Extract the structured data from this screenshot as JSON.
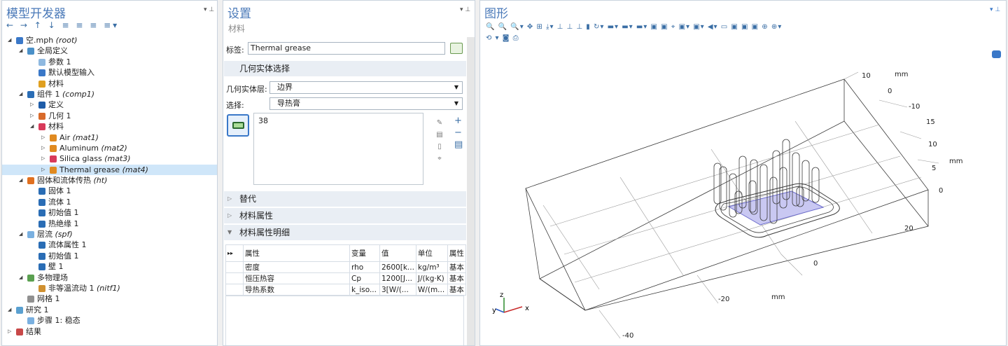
{
  "model_builder": {
    "title": "模型开发器",
    "tree": [
      {
        "label": "空.mph",
        "tag": "(root)",
        "level": 0,
        "toggle": "◢",
        "icon": "#3a78c8"
      },
      {
        "label": "全局定义",
        "tag": "",
        "level": 1,
        "toggle": "◢",
        "icon": "#4a90c8"
      },
      {
        "label": "参数 1",
        "tag": "",
        "level": 2,
        "toggle": "",
        "icon": "#8fb9e0"
      },
      {
        "label": "默认模型输入",
        "tag": "",
        "level": 2,
        "toggle": "",
        "icon": "#3a78c8"
      },
      {
        "label": "材料",
        "tag": "",
        "level": 2,
        "toggle": "",
        "icon": "#e0a020"
      },
      {
        "label": "组件 1",
        "tag": "(comp1)",
        "level": 1,
        "toggle": "◢",
        "icon": "#2a6db5"
      },
      {
        "label": "定义",
        "tag": "",
        "level": 2,
        "toggle": "▷",
        "icon": "#1e5ca8"
      },
      {
        "label": "几何 1",
        "tag": "",
        "level": 2,
        "toggle": "▷",
        "icon": "#d86a2a"
      },
      {
        "label": "材料",
        "tag": "",
        "level": 2,
        "toggle": "◢",
        "icon": "#d83a5a"
      },
      {
        "label": "Air",
        "tag": "(mat1)",
        "level": 3,
        "toggle": "▷",
        "icon": "#e08a20"
      },
      {
        "label": "Aluminum",
        "tag": "(mat2)",
        "level": 3,
        "toggle": "▷",
        "icon": "#e08a20"
      },
      {
        "label": "Silica glass",
        "tag": "(mat3)",
        "level": 3,
        "toggle": "▷",
        "icon": "#d83a5a"
      },
      {
        "label": "Thermal grease",
        "tag": "(mat4)",
        "level": 3,
        "toggle": "▷",
        "icon": "#e08a20",
        "selected": true
      },
      {
        "label": "固体和流体传热",
        "tag": "(ht)",
        "level": 1,
        "toggle": "◢",
        "icon": "#e07020"
      },
      {
        "label": "固体 1",
        "tag": "",
        "level": 2,
        "toggle": "",
        "icon": "#2a6db5"
      },
      {
        "label": "流体 1",
        "tag": "",
        "level": 2,
        "toggle": "",
        "icon": "#2a6db5"
      },
      {
        "label": "初始值 1",
        "tag": "",
        "level": 2,
        "toggle": "",
        "icon": "#2a6db5"
      },
      {
        "label": "热绝缘 1",
        "tag": "",
        "level": 2,
        "toggle": "",
        "icon": "#2a6db5"
      },
      {
        "label": "层流",
        "tag": "(spf)",
        "level": 1,
        "toggle": "◢",
        "icon": "#7ab0e0"
      },
      {
        "label": "流体属性 1",
        "tag": "",
        "level": 2,
        "toggle": "",
        "icon": "#2a6db5"
      },
      {
        "label": "初始值 1",
        "tag": "",
        "level": 2,
        "toggle": "",
        "icon": "#2a6db5"
      },
      {
        "label": "壁 1",
        "tag": "",
        "level": 2,
        "toggle": "",
        "icon": "#2a6db5"
      },
      {
        "label": "多物理场",
        "tag": "",
        "level": 1,
        "toggle": "◢",
        "icon": "#5aa050"
      },
      {
        "label": "非等温流动 1",
        "tag": "(nitf1)",
        "level": 2,
        "toggle": "",
        "icon": "#d09030"
      },
      {
        "label": "网格 1",
        "tag": "",
        "level": 1,
        "toggle": "",
        "icon": "#909090"
      },
      {
        "label": "研究 1",
        "tag": "",
        "level": 0,
        "toggle": "◢",
        "icon": "#5aa0d0"
      },
      {
        "label": "步骤 1: 稳态",
        "tag": "",
        "level": 1,
        "toggle": "",
        "icon": "#7ab0e0"
      },
      {
        "label": "结果",
        "tag": "",
        "level": 0,
        "toggle": "▷",
        "icon": "#c84848"
      }
    ]
  },
  "settings": {
    "title": "设置",
    "subtitle": "材料",
    "label_caption": "标签:",
    "label_value": "Thermal grease",
    "geom_section": "几何实体选择",
    "geom_level_caption": "几何实体层:",
    "geom_level_value": "边界",
    "selection_caption": "选择:",
    "selection_value": "导热膏",
    "selection_list": "38",
    "sections": [
      "替代",
      "材料属性",
      "材料属性明细"
    ],
    "table": {
      "headers": [
        "属性",
        "变量",
        "值",
        "单位",
        "属性"
      ],
      "rows": [
        [
          "密度",
          "rho",
          "2600[k...",
          "kg/m³",
          "基本"
        ],
        [
          "恒压热容",
          "Cp",
          "1200[J...",
          "J/(kg·K)",
          "基本"
        ],
        [
          "导热系数",
          "k_iso...",
          "3[W/(...",
          "W/(m...",
          "基本"
        ]
      ]
    }
  },
  "graphics": {
    "title": "图形",
    "toolbar_row1": "🔍 🔍 🔍▾ ✥ ⊞  ⤓▾  ⊥ ⊥ ⊥ ▮  ↻▾   ▬▾  ▬▾ ▬▾ ▣ ▣   ⌖ ▣▾  ▣▾   ◀▾ ▭ ▣ ▣ ▣  ⊕ ⊕▾",
    "toolbar_row2": "⟲ ▾  ◙ ⎙",
    "axis_labels": {
      "top": "10",
      "top_unit": "mm",
      "y0": "0",
      "y_m10": "-10",
      "r15": "15",
      "r10": "10",
      "r5": "5",
      "r_unit": "mm",
      "r0": "0",
      "r20": "20",
      "b0": "0",
      "b_m20": "-20",
      "b_unit": "mm",
      "b_m40": "-40"
    },
    "triad": {
      "z": "z",
      "y": "y",
      "x": "x"
    }
  }
}
